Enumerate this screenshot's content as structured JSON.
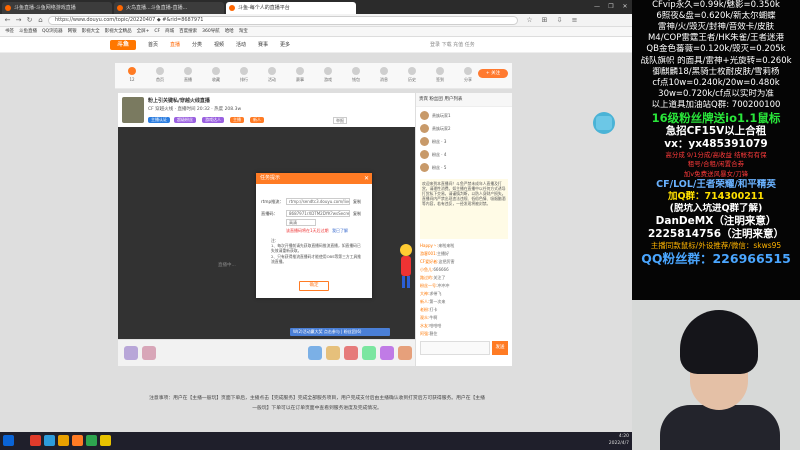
{
  "browser": {
    "tabs": [
      {
        "label": "斗鱼直播-斗鱼网络游戏直播",
        "active": false
      },
      {
        "label": "火鸟直播...斗鱼直播-直播...",
        "active": false
      },
      {
        "label": "斗鱼-每个人的直播平台",
        "active": true
      }
    ],
    "window_controls": [
      "—",
      "❐",
      "✕"
    ],
    "url": "https://www.douyu.com/topic/20220407 ◆ #&rid=8687971",
    "bookmarks": [
      "书签",
      "斗鱼直播",
      "QQ浏览器",
      "网银",
      "影视大全",
      "影视大全精品",
      "全屏+",
      "CF",
      "商城",
      "百度搜索",
      "360导航",
      "哈哈",
      "淘宝"
    ]
  },
  "site": {
    "logo": "斗鱼",
    "nav": [
      {
        "label": "首页",
        "highlight": false
      },
      {
        "label": "直播",
        "highlight": true
      },
      {
        "label": "分类",
        "highlight": false
      },
      {
        "label": "视频",
        "highlight": false
      },
      {
        "label": "活动",
        "highlight": false
      },
      {
        "label": "赛事",
        "highlight": false
      },
      {
        "label": "更多",
        "highlight": false
      }
    ],
    "header_right": "登录  下载  充值  任务",
    "subnav": [
      "12",
      "首页",
      "直播",
      "收藏",
      "排行",
      "活动",
      "赛事",
      "游戏",
      "钱包",
      "消息",
      "历史",
      "签到",
      "分享"
    ],
    "follow_label": "+ 关注"
  },
  "stream": {
    "room_title": "粉上引关键私/穿越火线直播",
    "host_line": "CF  穿越火线  ·  直播时间 20:32  ·  热度 208.3w",
    "tags": [
      {
        "label": "主播认证",
        "color": "#2b7de0"
      },
      {
        "label": "超级粉丝",
        "color": "#9a60e0"
      },
      {
        "label": "游戏达人",
        "color": "#9a60e0"
      },
      {
        "label": "主播",
        "color": "#ff7b24"
      },
      {
        "label": "新人",
        "color": "#ff7b24"
      }
    ],
    "report_label": "举报",
    "video_overlay_text": "直播中...",
    "danmu_banner": "W(2)活动赢大奖 点击参与 | 粉丝团(6)"
  },
  "dialog": {
    "title": "任务提示",
    "close": "✕",
    "rows": [
      {
        "label": "rtmp推流：",
        "value": "rtmp://sendtc3.douyu.com/live",
        "link": "复制"
      },
      {
        "label": "直播码：",
        "value": "8687971rXDTM2DYK?wsSecret=fd7",
        "link": "复制"
      }
    ],
    "select_value": "高清",
    "warn": "该直播码将在1天后过期",
    "warn_link": "我已了解",
    "notes": [
      "注：",
      "1、每次开播前请先获取直播码推流直播，如直播码已失效请重新获取。",
      "2、只有获得推流直播码才能使用OBS等第三方工具推流直播。"
    ],
    "ok_label": "确定"
  },
  "chat": {
    "header": "贵宾  粉丝团  用户列表",
    "rank": [
      "贵族玩家1",
      "贵族玩家2",
      "粉丝 · 3",
      "粉丝 · 4",
      "粉丝 · 5"
    ],
    "notice": "欢迎来到本直播间！斗鱼严禁未成年人直播及打赏，请理性消费。如主播在直播中以任何方式诱导打赏私下交易，请谨慎判断，以防人身财产损失。直播间内严禁出现违法违规、低俗色情、吸烟酗酒等内容，若有违反，一经发现将被封禁。",
    "lines": [
      {
        "user": "Happy丶:",
        "text": "来啦来啦"
      },
      {
        "user": "游客001:",
        "text": "主播好"
      },
      {
        "user": "CF爱好者:",
        "text": "这把厉害"
      },
      {
        "user": "小鱼儿:",
        "text": "666666"
      },
      {
        "user": "路过的:",
        "text": "关注了"
      },
      {
        "user": "粉丝一号:",
        "text": "冲冲冲"
      },
      {
        "user": "大神:",
        "text": "求带飞"
      },
      {
        "user": "新人:",
        "text": "第一次来"
      },
      {
        "user": "老粉:",
        "text": "打卡"
      },
      {
        "user": "观众:",
        "text": "牛啊"
      },
      {
        "user": "水友:",
        "text": "哈哈哈"
      },
      {
        "user": "阿强:",
        "text": "稳住"
      }
    ],
    "send_label": "发送"
  },
  "footer": "注意事项：用户在【主播一般玩】页面下单后，主播点击【完成服务】完成全部服务项目，用户完成支付后由主播确认收到打赏后方可获得服务。用户在【主播一般玩】下单可以在订单页面中查看到服务进度及完成情况。",
  "taskbar": {
    "time": "4:20",
    "date": "2022/4/7",
    "colors": [
      "#0a64d6",
      "#e03b2b",
      "#2d9cdb",
      "#e8a000",
      "#ff7b24",
      "#2ea44f",
      "#e8c200"
    ]
  },
  "overlay": {
    "lines": [
      {
        "text": "CFvip永久=0.99k/魅影=0.350k",
        "color": "#ffffff",
        "size": 8.5
      },
      {
        "text": "6照夜&盘=0.620k/新太尔蝴蝶",
        "color": "#ffffff",
        "size": 8.5
      },
      {
        "text": "雷神/火/毁灭/封神/音效卡/皮肤",
        "color": "#ffffff",
        "size": 8.5
      },
      {
        "text": "M4/COP雷霆王者/HK朱雀/王者迷港",
        "color": "#ffffff",
        "size": 8.5
      },
      {
        "text": "QB金色蕃薇=0.120k/毁灭=0.205k",
        "color": "#ffffff",
        "size": 8.5
      },
      {
        "text": "战队旗帜 的面具/雷神+光旋转=0.260k",
        "color": "#ffffff",
        "size": 8.5
      },
      {
        "text": "御麒麟18/黑骑士枚耐皮肤/雪莉杨",
        "color": "#ffffff",
        "size": 8.5
      },
      {
        "text": "cf点10w=0.240k/20w=0.480k",
        "color": "#ffffff",
        "size": 8.5
      },
      {
        "text": "30w=0.720k/cf点以实时为准",
        "color": "#ffffff",
        "size": 8.5
      },
      {
        "text": "以上道具加油站Q群: 700200100",
        "color": "#ffffff",
        "size": 8.5
      },
      {
        "text": "16级粉丝牌送io1.1鼠标",
        "color": "#29e63a",
        "size": 11.5
      },
      {
        "text": "急招CF15V以上合租",
        "color": "#ffffff",
        "size": 10.5
      },
      {
        "text": "vx：yx485391079",
        "color": "#ffffff",
        "size": 10.5
      },
      {
        "text": "高分成 9/1分成/高收益 结帐有有保",
        "color": "#ff3b3b",
        "size": 6.5
      },
      {
        "text": "租号/合租/闲置合券",
        "color": "#ff3b3b",
        "size": 6.5
      },
      {
        "text": "加v免费送风暴女/刀锋",
        "color": "#ff3b3b",
        "size": 6.5
      },
      {
        "text": "CF/LOL/王者荣耀/和平精英",
        "color": "#6ab2ff",
        "size": 9.5
      },
      {
        "text": "加Q群：714300211",
        "color": "#ffe000",
        "size": 9.5
      },
      {
        "text": "(脱坑入坑进Q群了解)",
        "color": "#ffffff",
        "size": 9.5
      },
      {
        "text": "DanDeMX（注明来意）",
        "color": "#ffffff",
        "size": 10.5
      },
      {
        "text": "2225814756（注明来意）",
        "color": "#ffffff",
        "size": 10.5
      },
      {
        "text": "主播同款鼠标/外设推荐/微信：skws95",
        "color": "#ffb400",
        "size": 7.5
      },
      {
        "text": "QQ粉丝群：226966515",
        "color": "#4aa6ff",
        "size": 12.5
      }
    ]
  }
}
